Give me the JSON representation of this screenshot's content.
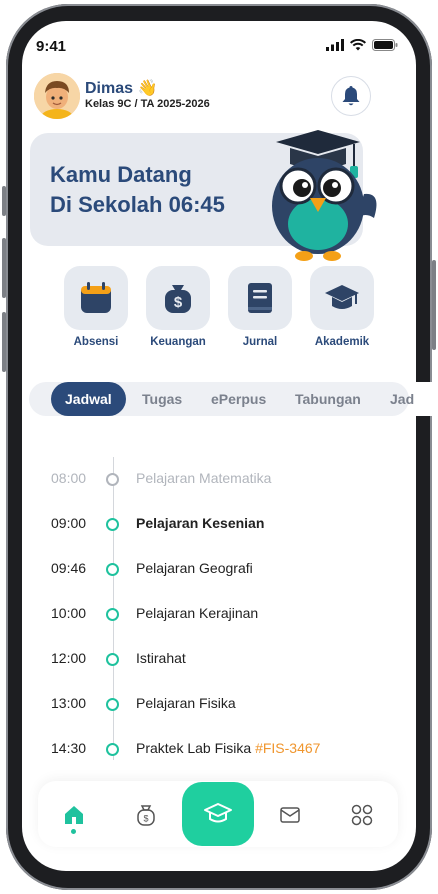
{
  "status": {
    "time": "9:41"
  },
  "user": {
    "name": "Dimas 👋",
    "class": "Kelas 9C / TA 2025-2026"
  },
  "banner": {
    "line1": "Kamu Datang",
    "line2": "Di Sekolah 06:45"
  },
  "menu": [
    {
      "label": "Absensi",
      "icon": "calendar-icon"
    },
    {
      "label": "Keuangan",
      "icon": "money-bag-icon"
    },
    {
      "label": "Jurnal",
      "icon": "book-icon"
    },
    {
      "label": "Akademik",
      "icon": "graduation-cap-icon"
    }
  ],
  "tabs": [
    "Jadwal",
    "Tugas",
    "ePerpus",
    "Tabungan",
    "Jad"
  ],
  "schedule": [
    {
      "time": "08:00",
      "label": "Pelajaran Matematika"
    },
    {
      "time": "09:00",
      "label": "Pelajaran Kesenian"
    },
    {
      "time": "09:46",
      "label": "Pelajaran Geografi"
    },
    {
      "time": "10:00",
      "label": "Pelajaran Kerajinan"
    },
    {
      "time": "12:00",
      "label": "Istirahat"
    },
    {
      "time": "13:00",
      "label": "Pelajaran Fisika"
    },
    {
      "time": "14:30",
      "label": "Praktek Lab Fisika",
      "code": "#FIS-3467"
    }
  ],
  "nav": [
    "home-icon",
    "money-bag-icon",
    "graduation-cap-icon",
    "mail-icon",
    "apps-grid-icon"
  ],
  "colors": {
    "primary": "#2b4a7a",
    "accent": "#1fcf9f",
    "code": "#f0962e"
  }
}
